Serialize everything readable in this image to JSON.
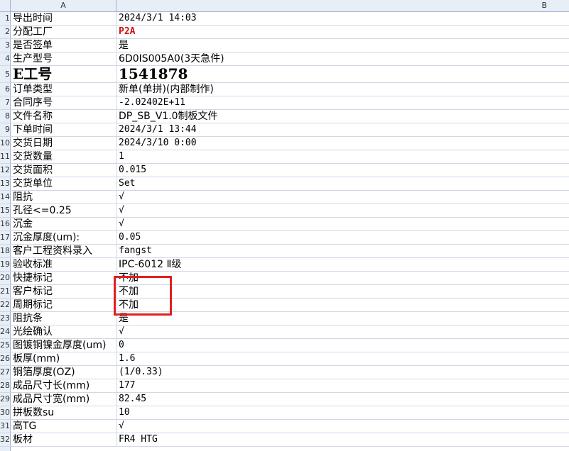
{
  "header": {
    "colA": "A",
    "colB": "B"
  },
  "colors": {
    "accent": "#d01010",
    "highlight": "#e02020",
    "grid": "#d0d7e5",
    "headerBg": "#e8eef7"
  },
  "rows": [
    {
      "n": "1",
      "a": "导出时间",
      "b": "2024/3/1 14:03"
    },
    {
      "n": "2",
      "a": "分配工厂",
      "b": "P2A"
    },
    {
      "n": "3",
      "a": "是否签单",
      "b": "是"
    },
    {
      "n": "4",
      "a": "生产型号",
      "b": "6D0IS005A0(3天急件)"
    },
    {
      "n": "5",
      "a": "E工号",
      "b": "1541878"
    },
    {
      "n": "6",
      "a": "订单类型",
      "b": "新单(单拼)(内部制作)"
    },
    {
      "n": "7",
      "a": "合同序号",
      "b": "-2.02402E+11"
    },
    {
      "n": "8",
      "a": "文件名称",
      "b": "DP_SB_V1.0制板文件"
    },
    {
      "n": "9",
      "a": "下单时间",
      "b": "2024/3/1 13:44"
    },
    {
      "n": "10",
      "a": "交货日期",
      "b": "2024/3/10 0:00"
    },
    {
      "n": "11",
      "a": "交货数量",
      "b": "1"
    },
    {
      "n": "12",
      "a": "交货面积",
      "b": "0.015"
    },
    {
      "n": "13",
      "a": "交货单位",
      "b": "Set"
    },
    {
      "n": "14",
      "a": "阻抗",
      "b": "√"
    },
    {
      "n": "15",
      "a": "孔径<=0.25",
      "b": "√"
    },
    {
      "n": "16",
      "a": "沉金",
      "b": "√"
    },
    {
      "n": "17",
      "a": "沉金厚度(um):",
      "b": "0.05"
    },
    {
      "n": "18",
      "a": "客户工程资料录入",
      "b": "fangst"
    },
    {
      "n": "19",
      "a": "验收标准",
      "b": "IPC-6012 Ⅱ级"
    },
    {
      "n": "20",
      "a": "快捷标记",
      "b": "不加"
    },
    {
      "n": "21",
      "a": "客户标记",
      "b": "不加"
    },
    {
      "n": "22",
      "a": "周期标记",
      "b": "不加"
    },
    {
      "n": "23",
      "a": "阻抗条",
      "b": "是"
    },
    {
      "n": "24",
      "a": "光绘确认",
      "b": "√"
    },
    {
      "n": "25",
      "a": "图镀铜镍金厚度(um)",
      "b": "0"
    },
    {
      "n": "26",
      "a": "板厚(mm)",
      "b": "1.6"
    },
    {
      "n": "27",
      "a": "铜箔厚度(OZ)",
      "b": "(1/0.33)"
    },
    {
      "n": "28",
      "a": "成品尺寸长(mm)",
      "b": "177"
    },
    {
      "n": "29",
      "a": "成品尺寸宽(mm)",
      "b": "82.45"
    },
    {
      "n": "30",
      "a": "拼板数su",
      "b": "10"
    },
    {
      "n": "31",
      "a": "高TG",
      "b": "√"
    },
    {
      "n": "32",
      "a": "板材",
      "b": "FR4 HTG"
    }
  ]
}
